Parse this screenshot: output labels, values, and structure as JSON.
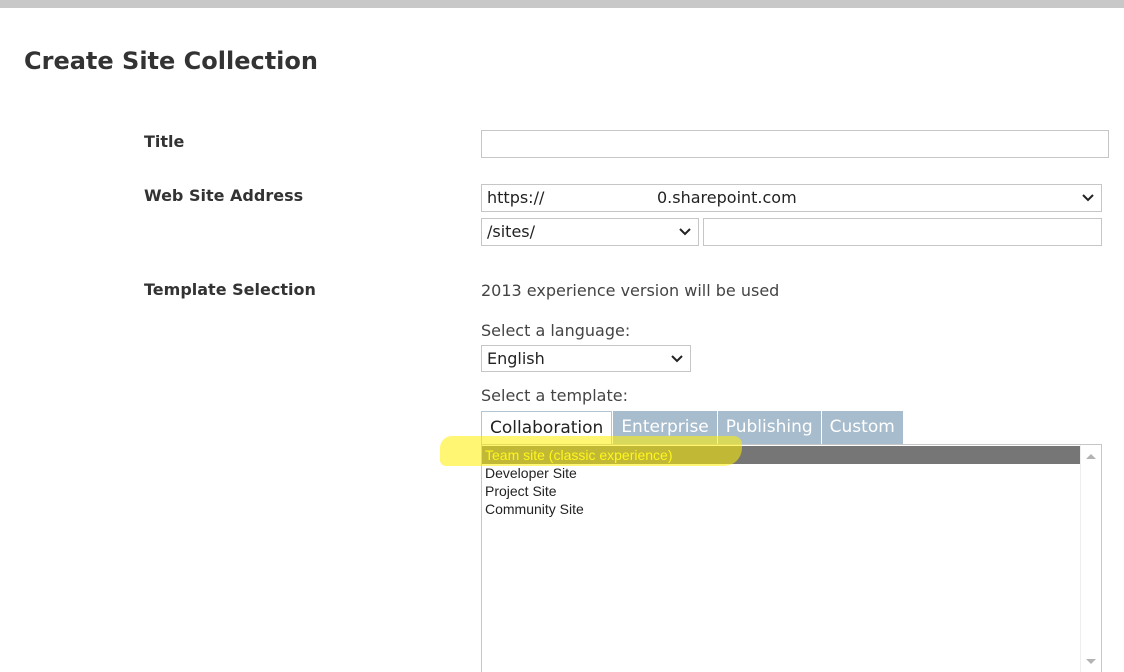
{
  "page": {
    "title": "Create Site Collection"
  },
  "form": {
    "title_label": "Title",
    "title_value": "",
    "address_label": "Web Site Address",
    "domain_prefix": "https://",
    "domain_suffix": "0.sharepoint.com",
    "path_value": "/sites/",
    "site_name_value": "",
    "template_label": "Template Selection",
    "experience_note": "2013 experience version will be used",
    "language_label": "Select a language:",
    "language_value": "English",
    "template_select_label": "Select a template:"
  },
  "tabs": [
    {
      "label": "Collaboration",
      "active": true
    },
    {
      "label": "Enterprise",
      "active": false
    },
    {
      "label": "Publishing",
      "active": false
    },
    {
      "label": "Custom",
      "active": false
    }
  ],
  "templates": [
    {
      "label": "Team site (classic experience)",
      "selected": true
    },
    {
      "label": "Developer Site",
      "selected": false
    },
    {
      "label": "Project Site",
      "selected": false
    },
    {
      "label": "Community Site",
      "selected": false
    }
  ],
  "icons": {
    "dropdown": "chevron-down-icon",
    "scroll_up": "scroll-up-arrow-icon",
    "scroll_down": "scroll-down-arrow-icon"
  },
  "colors": {
    "tab_inactive": "#a7bccd",
    "selected_row": "#767676",
    "selected_text": "#ffff40",
    "highlight": "#ffee00"
  }
}
